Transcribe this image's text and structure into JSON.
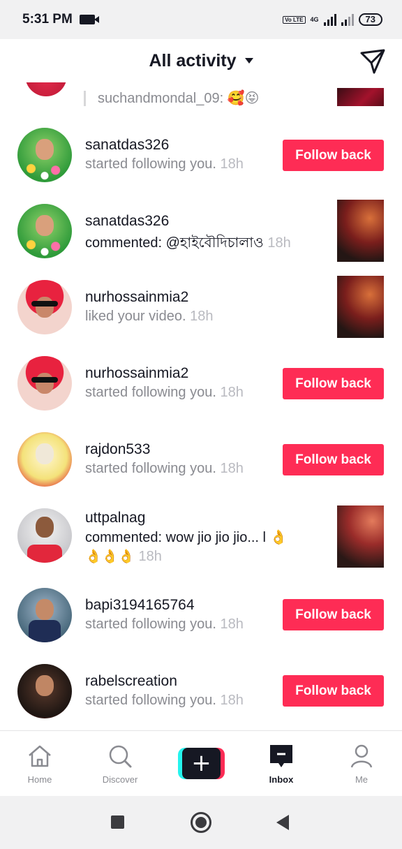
{
  "status_bar": {
    "time": "5:31 PM",
    "volte": "Vo LTE",
    "network": "4G",
    "battery": "73"
  },
  "header": {
    "title": "All activity"
  },
  "partial": {
    "text": "suchandmondal_09: 🥰😝"
  },
  "feed": [
    {
      "username": "sanatdas326",
      "text": "started following you.",
      "time": "18h",
      "action": "Follow back"
    },
    {
      "username": "sanatdas326",
      "text": "commented: @হাইবৌদিচালাও",
      "time": "18h",
      "action": "thumbnail"
    },
    {
      "username": "nurhossainmia2",
      "text": "liked your video.",
      "time": "18h",
      "action": "thumbnail"
    },
    {
      "username": "nurhossainmia2",
      "text": "started following you.",
      "time": "18h",
      "action": "Follow back"
    },
    {
      "username": "rajdon533",
      "text": "started following you.",
      "time": "18h",
      "action": "Follow back"
    },
    {
      "username": "uttpalnag",
      "text": "commented: wow jio jio jio... l 👌",
      "text2": "👌👌👌",
      "time": "18h",
      "action": "thumbnail"
    },
    {
      "username": "bapi3194165764",
      "text": "started following you.",
      "time": "18h",
      "action": "Follow back"
    },
    {
      "username": "rabelscreation",
      "text": "started following you.",
      "time": "18h",
      "action": "Follow back"
    }
  ],
  "nav": {
    "home": "Home",
    "discover": "Discover",
    "create": "+",
    "inbox": "Inbox",
    "me": "Me"
  },
  "colors": {
    "accent": "#fe2c55",
    "text": "#161823",
    "muted": "#8a8b91"
  }
}
